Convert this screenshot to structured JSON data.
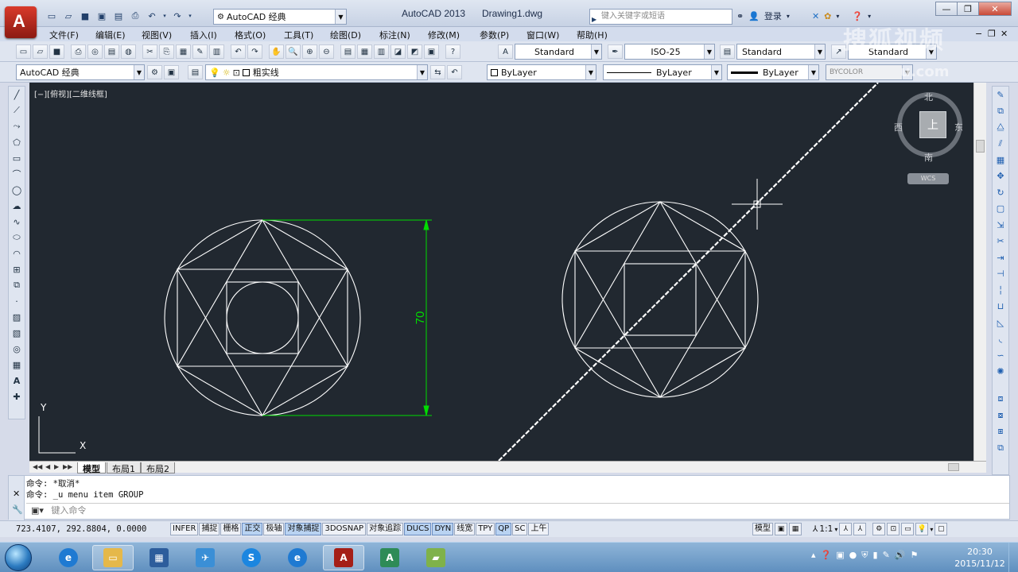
{
  "title_bar": {
    "workspace": "AutoCAD 经典",
    "app_name": "AutoCAD 2013",
    "document": "Drawing1.dwg",
    "search_placeholder": "键入关键字或短语",
    "login": "登录"
  },
  "menus": [
    "文件(F)",
    "编辑(E)",
    "视图(V)",
    "插入(I)",
    "格式(O)",
    "工具(T)",
    "绘图(D)",
    "标注(N)",
    "修改(M)",
    "参数(P)",
    "窗口(W)",
    "帮助(H)"
  ],
  "styles": {
    "text_style": "Standard",
    "dim_style": "ISO-25",
    "table_style": "Standard",
    "multileader_style": "Standard"
  },
  "workspace_toolbar": "AutoCAD 经典",
  "layer": "粗实线",
  "properties": {
    "color": "ByLayer",
    "linetype": "ByLayer",
    "lineweight": "ByLayer",
    "plot_style": "BYCOLOR"
  },
  "watermark": {
    "text": "搜狐视频",
    "sub": "u.com"
  },
  "viewport_label": "[−][俯视][二维线框]",
  "viewcube": {
    "face": "上",
    "north": "北",
    "south": "南",
    "east": "东",
    "west": "西",
    "wcs": "WCS"
  },
  "ucs": {
    "x": "X",
    "y": "Y"
  },
  "drawing": {
    "dimension_text": "70",
    "line_color": "#ffffff",
    "dim_color": "#00dd00"
  },
  "tabs": [
    "模型",
    "布局1",
    "布局2"
  ],
  "command": {
    "history": [
      "命令: *取消*",
      "命令: _u menu item GROUP"
    ],
    "placeholder": "键入命令"
  },
  "status": {
    "coordinates": "723.4107, 292.8804, 0.0000",
    "toggles": [
      {
        "label": "INFER",
        "on": false
      },
      {
        "label": "捕捉",
        "on": false
      },
      {
        "label": "栅格",
        "on": false
      },
      {
        "label": "正交",
        "on": true
      },
      {
        "label": "极轴",
        "on": false
      },
      {
        "label": "对象捕捉",
        "on": true
      },
      {
        "label": "3DOSNAP",
        "on": false
      },
      {
        "label": "对象追踪",
        "on": false
      },
      {
        "label": "DUCS",
        "on": true
      },
      {
        "label": "DYN",
        "on": true
      },
      {
        "label": "线宽",
        "on": false
      },
      {
        "label": "TPY",
        "on": false
      },
      {
        "label": "QP",
        "on": true
      },
      {
        "label": "SC",
        "on": false
      },
      {
        "label": "上午",
        "on": false
      }
    ],
    "model": "模型",
    "annotation_scale": "1:1"
  },
  "taskbar": {
    "time": "20:30",
    "date": "2015/11/12"
  }
}
